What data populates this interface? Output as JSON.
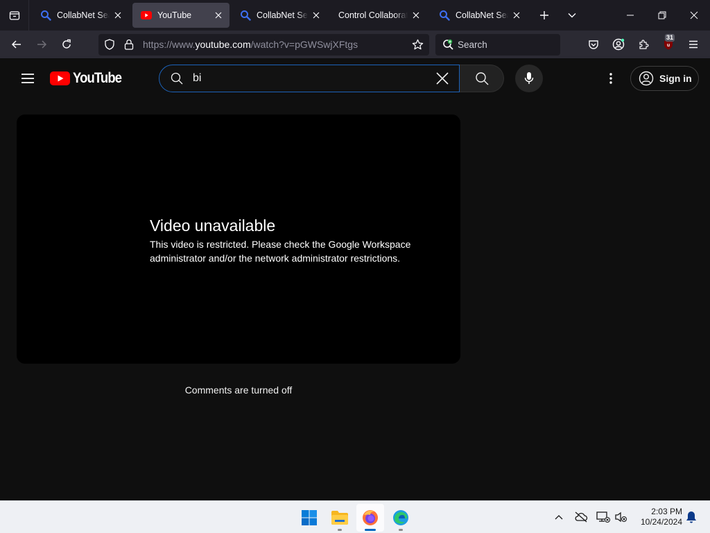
{
  "browser": {
    "tabs": [
      {
        "title": "CollabNet SearXNG",
        "favicon": "search-magnifier-icon",
        "active": false
      },
      {
        "title": "YouTube",
        "favicon": "youtube-icon",
        "active": true
      },
      {
        "title": "CollabNet SearXNG",
        "favicon": "search-magnifier-icon",
        "active": false
      },
      {
        "title": "Control Collaborative",
        "favicon": "none",
        "active": false
      },
      {
        "title": "CollabNet SearXNG",
        "favicon": "search-magnifier-icon",
        "active": false
      }
    ],
    "url": {
      "prefix": "https://www.",
      "host": "youtube.com",
      "path": "/watch?v=pGWSwjXFtgs"
    },
    "search_placeholder": "Search",
    "extension_badge": "31",
    "colors": {
      "tabstrip": "#1c1b22",
      "active_tab": "#42414d",
      "toolbar": "#2b2a33"
    }
  },
  "youtube": {
    "logo_text": "YouTube",
    "search_query": "bi",
    "sign_in_label": "Sign in",
    "error_title": "Video unavailable",
    "error_message": "This video is restricted. Please check the Google Workspace administrator and/or the network administrator restrictions.",
    "comments_status": "Comments are turned off",
    "colors": {
      "background": "#0f0f0f",
      "brand_red": "#ff0000",
      "search_focus": "#1c62b9"
    }
  },
  "taskbar": {
    "apps": [
      "windows-start",
      "file-explorer",
      "firefox",
      "edge"
    ],
    "time": "2:03 PM",
    "date": "10/24/2024"
  }
}
